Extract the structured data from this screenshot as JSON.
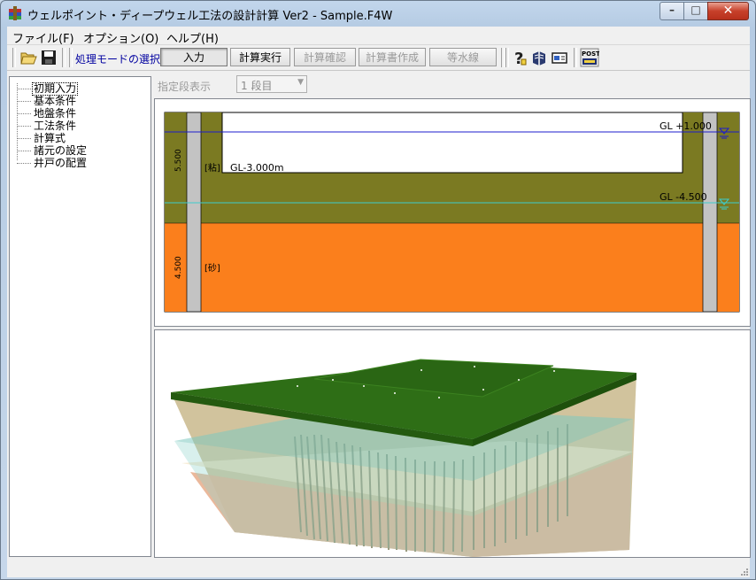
{
  "window": {
    "title": "ウェルポイント・ディープウェル工法の設計計算 Ver2 - Sample.F4W",
    "minimize_label": "–",
    "maximize_label": "□",
    "close_label": "✕"
  },
  "menu": [
    {
      "label": "ファイル(F)"
    },
    {
      "label": "オプション(O)"
    },
    {
      "label": "ヘルプ(H)"
    }
  ],
  "toolbar": {
    "mode_label": "処理モードの選択",
    "buttons": [
      {
        "label": "入力",
        "state": "pressed"
      },
      {
        "label": "計算実行",
        "state": "enabled"
      },
      {
        "label": "計算確認",
        "state": "disabled"
      },
      {
        "label": "計算書作成",
        "state": "disabled"
      },
      {
        "label": "等水線",
        "state": "disabled"
      }
    ],
    "icons": [
      "open-folder-icon",
      "save-icon",
      "help-icon",
      "book-icon",
      "card-icon",
      "post-icon"
    ],
    "post_icon_text": "POST"
  },
  "tree": {
    "items": [
      {
        "label": "初期入力",
        "selected": true
      },
      {
        "label": "基本条件"
      },
      {
        "label": "地盤条件"
      },
      {
        "label": "工法条件"
      },
      {
        "label": "計算式"
      },
      {
        "label": "諸元の設定"
      },
      {
        "label": "井戸の配置"
      }
    ]
  },
  "filter": {
    "label": "指定段表示",
    "value": "1 段目"
  },
  "section": {
    "gl_top_label": "GL  +1.000",
    "gl_water_label": "GL  -4.500",
    "excavation_label": "GL-3.000m",
    "layer1_name": "[粘]",
    "layer2_name": "[砂]",
    "layer1_thickness": "5.500",
    "layer2_thickness": "4.500",
    "colors": {
      "clay": "#7b7a22",
      "sand": "#fb7f1c",
      "water_line_top": "#1c1ccc",
      "water_line_mid": "#3ccccc",
      "pile": "#c3c3c3"
    }
  },
  "view3d": {
    "colors": {
      "top": "#2e6e16",
      "water": "#7ec9c0",
      "clay_side": "#c9b88c",
      "sand_side": "#e8b090"
    }
  }
}
